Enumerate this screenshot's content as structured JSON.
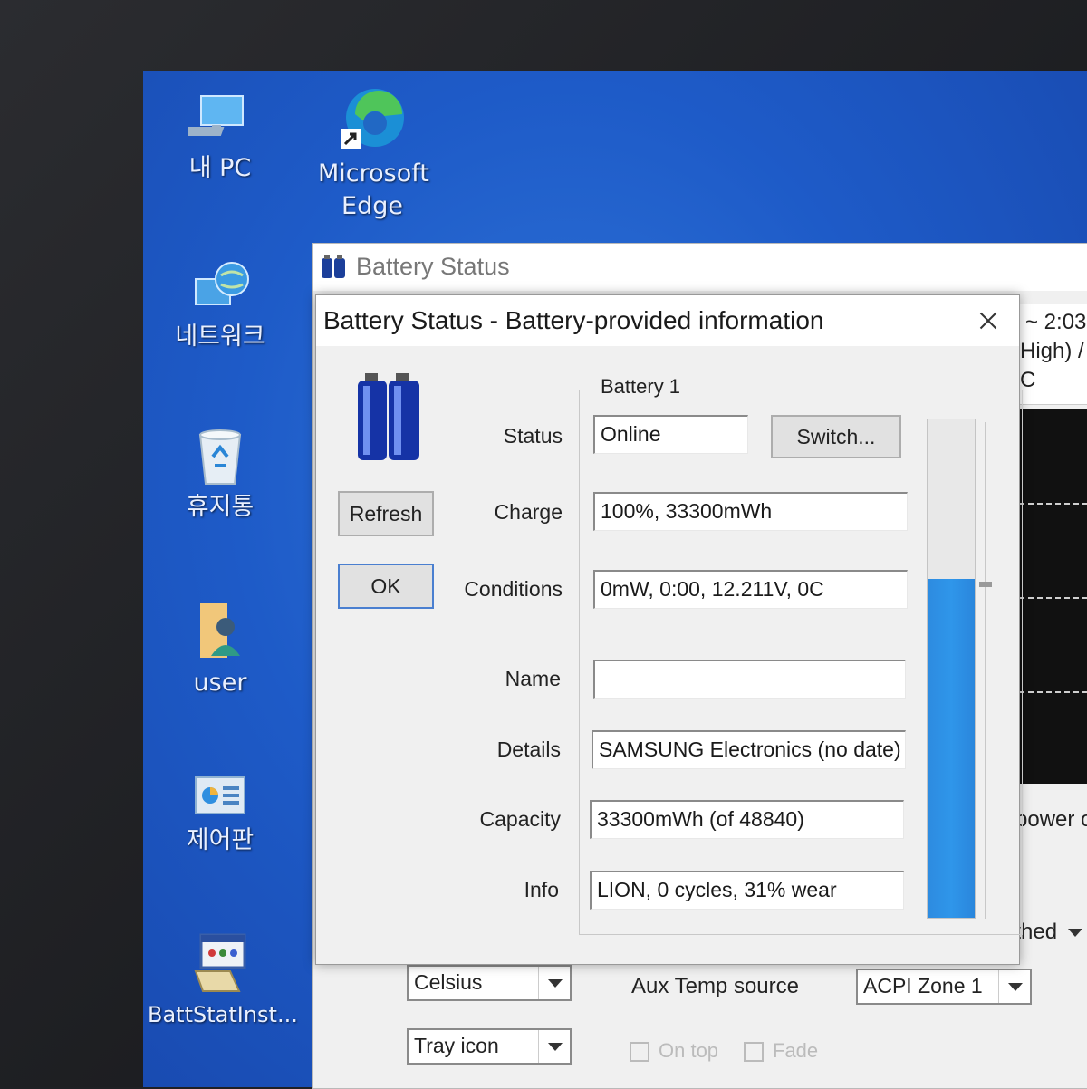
{
  "desktop": {
    "icons": [
      {
        "label": "내 PC",
        "icon": "computer-icon"
      },
      {
        "label": "Microsoft Edge",
        "icon": "edge-icon"
      },
      {
        "label": "네트워크",
        "icon": "network-icon"
      },
      {
        "label": "휴지통",
        "icon": "recycle-bin-icon"
      },
      {
        "label": "user",
        "icon": "user-folder-icon"
      },
      {
        "label": "제어판",
        "icon": "control-panel-icon"
      },
      {
        "label": "BattStatInst...",
        "icon": "installer-icon"
      }
    ]
  },
  "main_window": {
    "title": "Battery Status",
    "fragments": {
      "time": "~ 2:03",
      "high": "High) /",
      "c": "C",
      "power": "power of",
      "ithed": "ithed"
    },
    "units_value": "Celsius",
    "aux_temp_label": "Aux Temp source",
    "aux_temp_value": "ACPI Zone 1",
    "tray_value": "Tray icon",
    "on_top_label": "On top",
    "fade_label": "Fade"
  },
  "dialog": {
    "title": "Battery Status - Battery-provided information",
    "refresh_label": "Refresh",
    "ok_label": "OK",
    "group_label": "Battery 1",
    "switch_label": "Switch...",
    "status_label": "Status",
    "status_value": "Online",
    "charge_label": "Charge",
    "charge_value": "100%, 33300mWh",
    "conditions_label": "Conditions",
    "conditions_value": "0mW, 0:00, 12.211V, 0C",
    "name_label": "Name",
    "name_value": "",
    "details_label": "Details",
    "details_value": "SAMSUNG Electronics (no date)",
    "capacity_label": "Capacity",
    "capacity_value": "33300mWh (of 48840)",
    "info_label": "Info",
    "info_value": "LION, 0 cycles, 31% wear",
    "charge_level": 0.68,
    "colors": {
      "gauge": "#2d8be0",
      "desktop": "#1e5bc8"
    }
  }
}
